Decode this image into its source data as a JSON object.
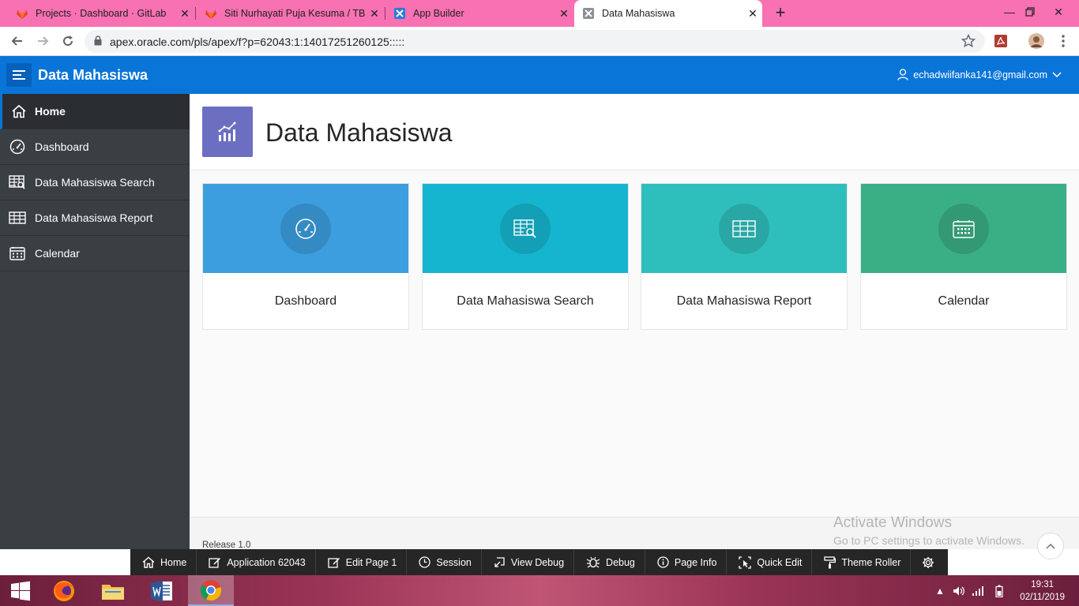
{
  "browser": {
    "tabs": [
      {
        "title": "Projects · Dashboard · GitLab",
        "icon": "gitlab-icon"
      },
      {
        "title": "Siti Nurhayati Puja Kesuma / TB D",
        "icon": "gitlab-icon"
      },
      {
        "title": "App Builder",
        "icon": "apex-icon"
      },
      {
        "title": "Data Mahasiswa",
        "icon": "apex-icon"
      }
    ],
    "active_tab": 3,
    "new_tab": "+",
    "url": "apex.oracle.com/pls/apex/f?p=62043:1:14017251260125:::::"
  },
  "header": {
    "app_title": "Data Mahasiswa",
    "user": "echadwiifanka141@gmail.com"
  },
  "sidebar": {
    "items": [
      {
        "label": "Home",
        "icon": "home-icon",
        "active": true
      },
      {
        "label": "Dashboard",
        "icon": "dashboard-icon",
        "active": false
      },
      {
        "label": "Data Mahasiswa Search",
        "icon": "search-table-icon",
        "active": false
      },
      {
        "label": "Data Mahasiswa Report",
        "icon": "table-icon",
        "active": false
      },
      {
        "label": "Calendar",
        "icon": "calendar-icon",
        "active": false
      }
    ]
  },
  "main": {
    "title": "Data Mahasiswa",
    "cards": [
      {
        "label": "Dashboard",
        "icon": "dashboard-icon",
        "color": "#3c9ede"
      },
      {
        "label": "Data Mahasiswa Search",
        "icon": "search-table-icon",
        "color": "#16b5cf"
      },
      {
        "label": "Data Mahasiswa Report",
        "icon": "table-icon",
        "color": "#2ebfbc"
      },
      {
        "label": "Calendar",
        "icon": "calendar-icon",
        "color": "#3aaf85"
      }
    ],
    "release": "Release 1.0"
  },
  "watermark": {
    "line1": "Activate Windows",
    "line2": "Go to PC settings to activate Windows."
  },
  "devbar": {
    "items": [
      {
        "label": "Home",
        "icon": "home-icon"
      },
      {
        "label": "Application 62043",
        "icon": "edit-icon"
      },
      {
        "label": "Edit Page 1",
        "icon": "edit-icon"
      },
      {
        "label": "Session",
        "icon": "clock-icon"
      },
      {
        "label": "View Debug",
        "icon": "view-debug-icon"
      },
      {
        "label": "Debug",
        "icon": "bug-icon"
      },
      {
        "label": "Page Info",
        "icon": "info-icon"
      },
      {
        "label": "Quick Edit",
        "icon": "quick-edit-icon"
      },
      {
        "label": "Theme Roller",
        "icon": "paint-roller-icon"
      }
    ]
  },
  "taskbar": {
    "time": "19:31",
    "date": "02/11/2019"
  },
  "colors": {
    "header": "#0a75d8",
    "sidebar": "#3a3f44",
    "tabstrip": "#f871b2",
    "hero_icon": "#6c6fc1"
  }
}
